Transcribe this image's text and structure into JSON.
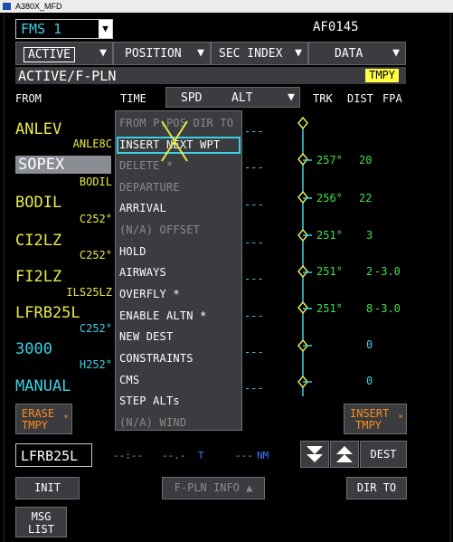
{
  "window": {
    "title": "A380X_MFD"
  },
  "fms_selector": {
    "label": "FMS 1"
  },
  "flight_id": "AF0145",
  "menu": [
    {
      "label": "ACTIVE",
      "boxed": true
    },
    {
      "label": "POSITION"
    },
    {
      "label": "SEC INDEX"
    },
    {
      "label": "DATA"
    }
  ],
  "page_title": "ACTIVE/F-PLN",
  "tmpy_badge": "TMPY",
  "columns": {
    "from": "FROM",
    "time": "TIME",
    "spd": "SPD",
    "alt": "ALT",
    "trk": "TRK",
    "dist": "DIST",
    "fpa": "FPA"
  },
  "waypoints": [
    {
      "name": "ANLEV",
      "color": "#eaea4a",
      "alt": "---"
    },
    {
      "name": "SOPEX",
      "color": "#ffffff",
      "selected": true,
      "alt": "---"
    },
    {
      "name": "BODIL",
      "color": "#eaea4a",
      "alt": "---"
    },
    {
      "name": "CI2LZ",
      "color": "#eaea4a",
      "alt": "---"
    },
    {
      "name": "FI2LZ",
      "color": "#eaea4a",
      "alt": "---"
    },
    {
      "name": "LFRB25L",
      "color": "#eaea4a",
      "alt": "---"
    },
    {
      "name": "3000",
      "color": "#3ad1e6",
      "alt": "---"
    },
    {
      "name": "MANUAL",
      "color": "#3ad1e6",
      "alt": "---"
    }
  ],
  "legs": [
    {
      "desc": "ANLE8C",
      "desc_color": "#eaea4a",
      "trk": "257°",
      "dist": "20",
      "fpa": ""
    },
    {
      "desc": "BODIL",
      "desc_color": "#eaea4a",
      "trk": "256°",
      "dist": "22",
      "fpa": ""
    },
    {
      "desc": "C252°",
      "desc_color": "#eaea4a",
      "trk": "251°",
      "dist": "3",
      "fpa": ""
    },
    {
      "desc": "C252°",
      "desc_color": "#eaea4a",
      "trk": "251°",
      "dist": "2",
      "fpa": "-3.0"
    },
    {
      "desc": "ILS25LZ",
      "desc_color": "#eaea4a",
      "trk": "251°",
      "dist": "8",
      "fpa": "-3.0"
    },
    {
      "desc": "C252°",
      "desc_color": "#3ad1e6",
      "trk": "",
      "dist": "0",
      "fpa": ""
    },
    {
      "desc": "H252°",
      "desc_color": "#3ad1e6",
      "trk": "",
      "dist": "0",
      "fpa": ""
    }
  ],
  "context_menu": {
    "items": [
      {
        "label": "FROM P.POS DIR TO",
        "enabled": false
      },
      {
        "label": "INSERT NEXT WPT",
        "enabled": true,
        "highlighted": true
      },
      {
        "label": "DELETE *",
        "enabled": false
      },
      {
        "label": "DEPARTURE",
        "enabled": false
      },
      {
        "label": "ARRIVAL",
        "enabled": true
      },
      {
        "label": "(N/A) OFFSET",
        "enabled": false
      },
      {
        "label": "HOLD",
        "enabled": true
      },
      {
        "label": "AIRWAYS",
        "enabled": true
      },
      {
        "label": "OVERFLY *",
        "enabled": true
      },
      {
        "label": "ENABLE ALTN *",
        "enabled": true
      },
      {
        "label": "NEW DEST",
        "enabled": true
      },
      {
        "label": "CONSTRAINTS",
        "enabled": true
      },
      {
        "label": "CMS",
        "enabled": true
      },
      {
        "label": "STEP ALTs",
        "enabled": true
      },
      {
        "label": "(N/A) WIND",
        "enabled": false
      }
    ]
  },
  "buttons": {
    "erase_tmpy": [
      "ERASE",
      "TMPY"
    ],
    "insert_tmpy": [
      "INSERT",
      "TMPY"
    ],
    "star": "*",
    "dest_btn": "DEST",
    "init": "INIT",
    "fpln_info": "F-PLN INFO ▲",
    "dir_to": "DIR TO",
    "msg_list": [
      "MSG",
      "LIST"
    ]
  },
  "dest_row": {
    "airport": "LFRB25L",
    "time": "--:--",
    "efob": "--.-",
    "efob_unit": "T",
    "dist": "---",
    "dist_unit": "NM"
  },
  "colors": {
    "cyan": "#3ad1e6",
    "yellow": "#eaea4a",
    "green": "#42e04a",
    "amber": "#ff8a1a",
    "panel": "#3a3c40"
  }
}
